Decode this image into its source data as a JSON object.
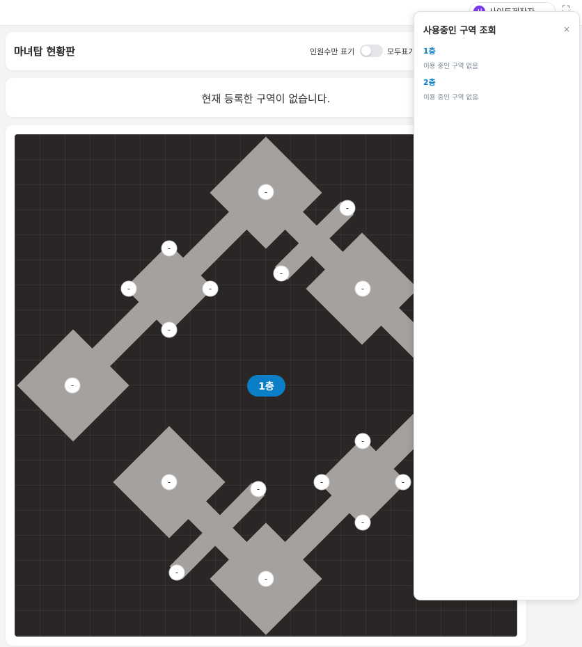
{
  "topbar": {
    "user_initial": "시",
    "user_name": "사이트제작자",
    "chevron": "⌄",
    "fullscreen_icon": "⛶"
  },
  "header": {
    "title": "마녀탑 현황판",
    "toggle_label": "인원수만 표기",
    "toggle_on": false,
    "show_all_label": "모두표기"
  },
  "notice": {
    "text": "현재 등록한 구역이 없습니다."
  },
  "map": {
    "floor_badge": "1층",
    "node_label": "-",
    "colors": {
      "background": "#2a2625",
      "room": "#a5a19e",
      "badge": "#0a7fc7"
    }
  },
  "panel": {
    "title": "사용중인 구역 조회",
    "close_icon": "×",
    "floors": [
      {
        "name": "1층",
        "status": "이용 중인 구역 없음"
      },
      {
        "name": "2층",
        "status": "이용 중인 구역 없음"
      }
    ]
  }
}
